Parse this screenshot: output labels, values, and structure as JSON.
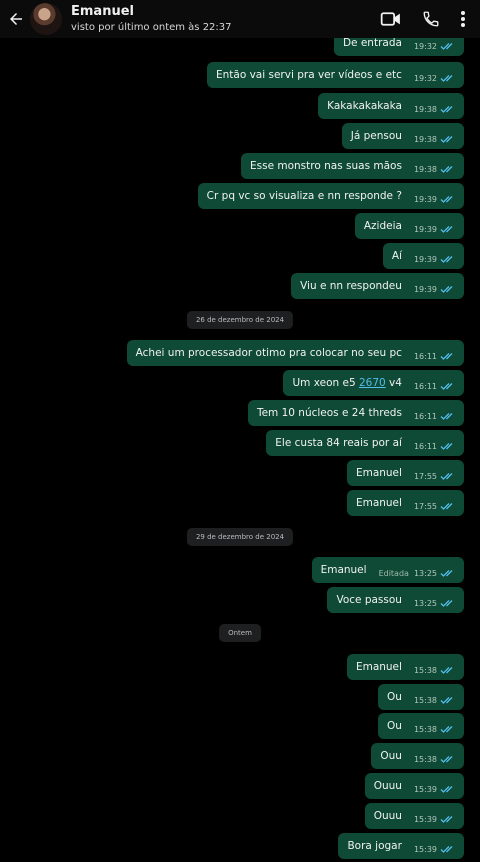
{
  "header": {
    "contact_name": "Emanuel",
    "last_seen": "visto por último ontem às 22:37",
    "icons": [
      "back-arrow-icon",
      "video-call-icon",
      "phone-icon",
      "more-options-icon"
    ]
  },
  "colors": {
    "bubble_out": "#0e4a35",
    "tick_read": "#53bdeb",
    "background": "#000000",
    "date_chip": "#1d1f21"
  },
  "chat": {
    "messages_block_1": [
      {
        "text": "De entrada",
        "time": "19:32"
      },
      {
        "text": "Então vai servi pra ver vídeos e etc",
        "time": "19:32"
      },
      {
        "text": "Kakakakakaka",
        "time": "19:38"
      },
      {
        "text": "Já pensou",
        "time": "19:38"
      },
      {
        "text": "Esse monstro nas suas mãos",
        "time": "19:38"
      },
      {
        "text": "Cr pq vc so visualiza e nn responde ?",
        "time": "19:39"
      },
      {
        "text": "Azideia",
        "time": "19:39"
      },
      {
        "text": "Aí",
        "time": "19:39"
      },
      {
        "text": "Viu e nn respondeu",
        "time": "19:39"
      }
    ],
    "date_1": "26 de dezembro de 2024",
    "messages_block_2": [
      {
        "text": "Achei um processador otimo pra colocar no seu pc",
        "time": "16:11"
      },
      {
        "text_before": "Um xeon e5 ",
        "link": "2670",
        "text_after": " v4",
        "time": "16:11"
      },
      {
        "text": "Tem 10 núcleos e 24 threds",
        "time": "16:11"
      },
      {
        "text": "Ele custa 84 reais por aí",
        "time": "16:11"
      },
      {
        "text": "Emanuel",
        "time": "17:55"
      },
      {
        "text": "Emanuel",
        "time": "17:55"
      }
    ],
    "date_2": "29 de dezembro de 2024",
    "messages_block_3": [
      {
        "text": "Emanuel",
        "edited": "Editada",
        "time": "13:25"
      },
      {
        "text": "Voce passou",
        "time": "13:25"
      }
    ],
    "date_3": "Ontem",
    "messages_block_4": [
      {
        "text": "Emanuel",
        "time": "15:38"
      },
      {
        "text": "Ou",
        "time": "15:38"
      },
      {
        "text": "Ou",
        "time": "15:38"
      },
      {
        "text": "Ouu",
        "time": "15:38"
      },
      {
        "text": "Ouuu",
        "time": "15:39"
      },
      {
        "text": "Ouuu",
        "time": "15:39"
      },
      {
        "text": "Bora jogar",
        "time": "15:39"
      }
    ]
  }
}
